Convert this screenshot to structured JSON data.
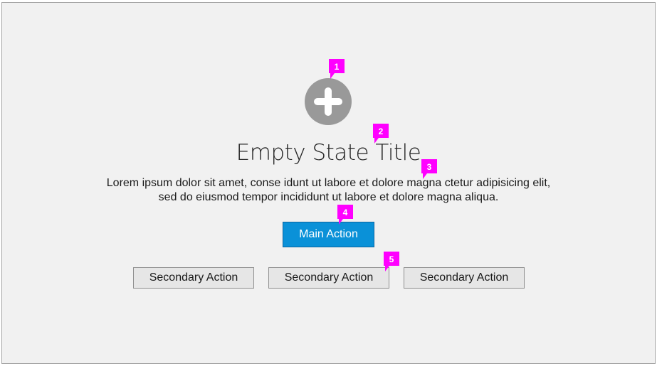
{
  "empty_state": {
    "icon": "plus-circle-icon",
    "title": "Empty State Title",
    "description_line1": "Lorem ipsum dolor sit amet, conse idunt ut labore et dolore magna  ctetur adipisicing elit,",
    "description_line2": "sed do eiusmod tempor incididunt ut labore et dolore magna aliqua.",
    "main_action_label": "Main Action",
    "secondary_actions": [
      {
        "label": "Secondary Action"
      },
      {
        "label": "Secondary Action"
      },
      {
        "label": "Secondary Action"
      }
    ]
  },
  "annotations": [
    {
      "number": "1"
    },
    {
      "number": "2"
    },
    {
      "number": "3"
    },
    {
      "number": "4"
    },
    {
      "number": "5"
    }
  ],
  "colors": {
    "background": "#f1f1f1",
    "icon": "#999999",
    "primary": "#0a91d8",
    "annotation": "#ff00ff"
  }
}
